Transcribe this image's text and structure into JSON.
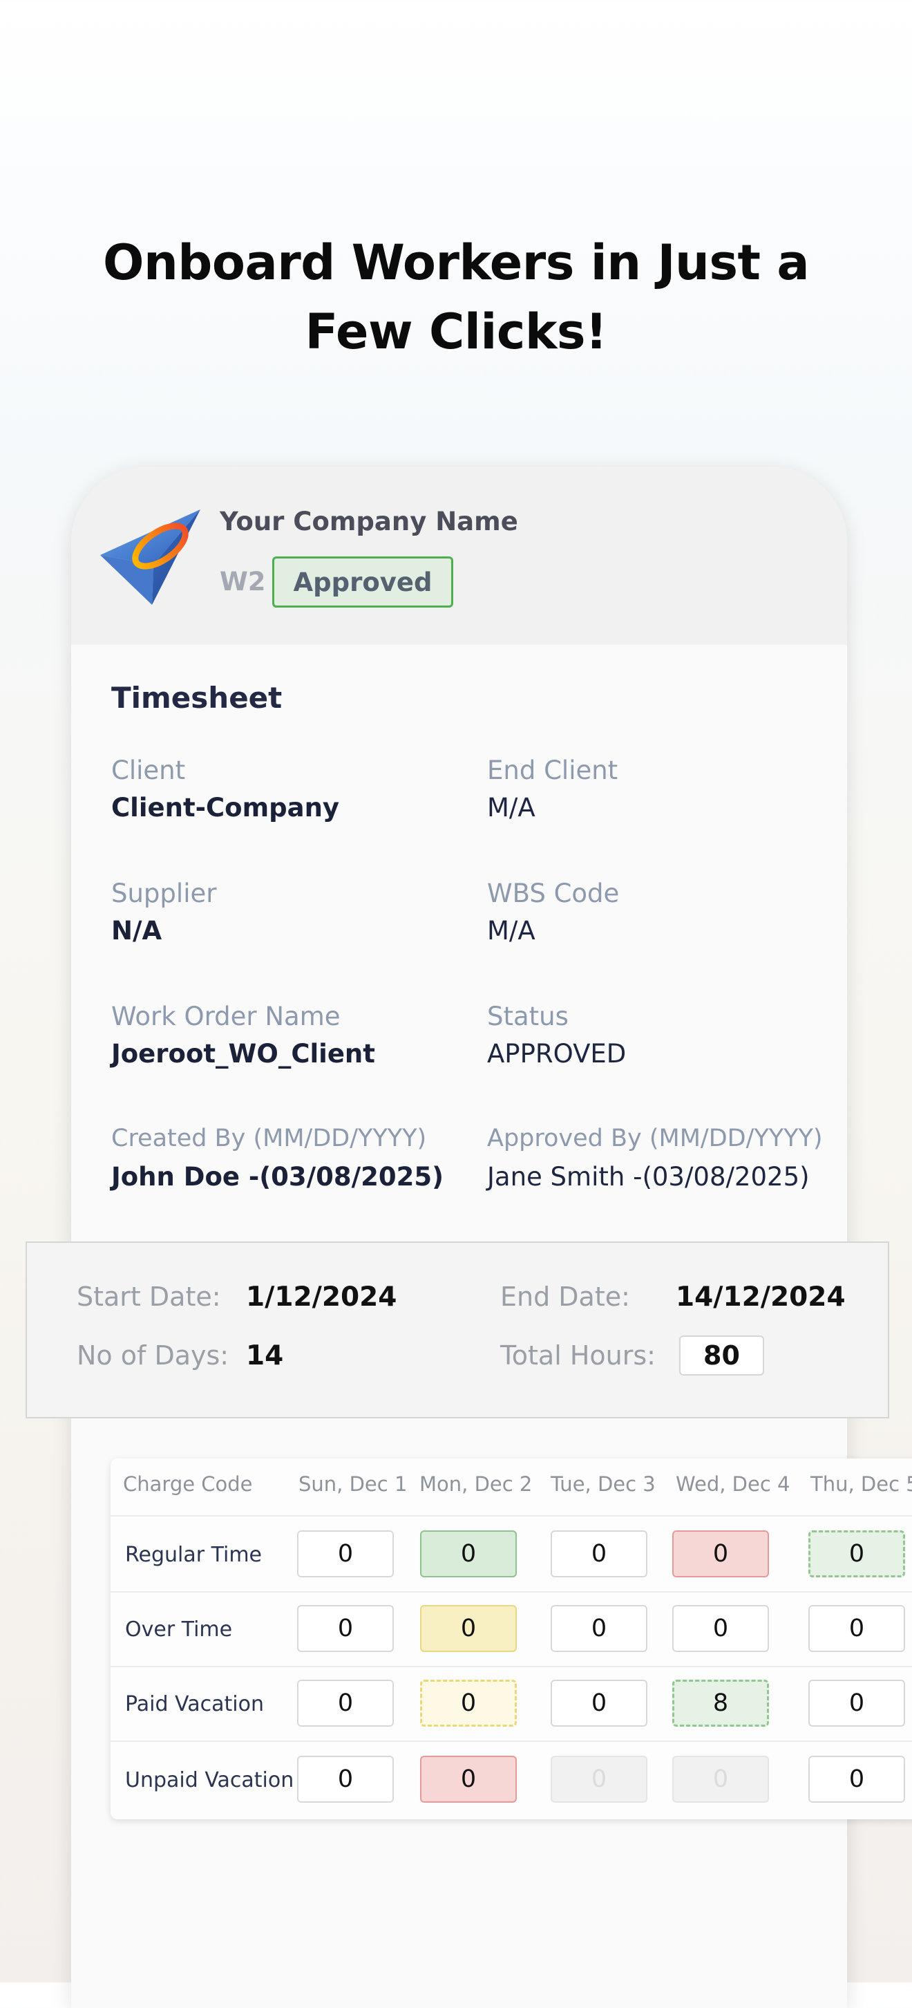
{
  "headline": {
    "line1": "Onboard Workers in Just a",
    "line2": "Few Clicks!"
  },
  "card": {
    "company_name": "Your Company Name",
    "type_label": "W2",
    "status_badge": "Approved",
    "section_title": "Timesheet",
    "fields": {
      "client_label": "Client",
      "client_value": "Client-Company",
      "end_client_label": "End Client",
      "end_client_value": "M/A",
      "supplier_label": "Supplier",
      "supplier_value": "N/A",
      "wbs_label": "WBS Code",
      "wbs_value": "M/A",
      "work_order_label": "Work Order Name",
      "work_order_value": "Joeroot_WO_Client",
      "status_label": "Status",
      "status_value": "APPROVED",
      "created_label": "Created By (MM/DD/YYYY)",
      "created_value": "John Doe -(03/08/2025)",
      "approved_label": "Approved By (MM/DD/YYYY)",
      "approved_value": "Jane Smith -(03/08/2025)"
    }
  },
  "summary": {
    "start_label": "Start Date:",
    "start_value": "1/12/2024",
    "end_label": "End Date:",
    "end_value": "14/12/2024",
    "days_label": "No of Days:",
    "days_value": "14",
    "hours_label": "Total Hours:",
    "hours_value": "80"
  },
  "table": {
    "headers": [
      "Charge Code",
      "Sun,  Dec 1",
      "Mon,  Dec 2",
      "Tue,  Dec 3",
      "Wed,  Dec 4",
      "Thu,  Dec 5"
    ],
    "rows": [
      {
        "label": "Regular Time",
        "values": [
          "0",
          "0",
          "0",
          "0",
          "0"
        ]
      },
      {
        "label": "Over Time",
        "values": [
          "0",
          "0",
          "0",
          "0",
          "0"
        ]
      },
      {
        "label": "Paid Vacation",
        "values": [
          "0",
          "0",
          "0",
          "8",
          "0"
        ]
      },
      {
        "label": "Unpaid Vacation",
        "values": [
          "0",
          "0",
          "0",
          "0",
          "0"
        ]
      }
    ]
  },
  "colors": {
    "approved_border": "#4caf50",
    "cell_green": "#d9ebd9",
    "cell_red": "#f7d6d6",
    "cell_yellow": "#f8efc2"
  }
}
